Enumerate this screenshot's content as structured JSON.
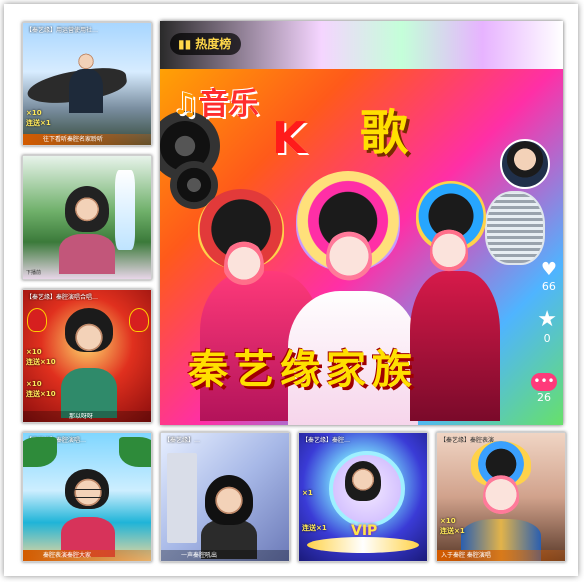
{
  "main": {
    "hot_chip": "热度榜",
    "music": "音乐",
    "k": "K",
    "ge": "歌",
    "family": "秦艺缘家族",
    "likes": "66",
    "comments": "0",
    "shares": "26"
  },
  "tiles": {
    "t1": {
      "top": "【秦艺缘】用运营使用社…",
      "fee1": "×10",
      "fee2": "连送×1",
      "bottom": "往下看听秦腔名家聆听"
    },
    "t2": {
      "top": "",
      "bottom": "下播前"
    },
    "t3": {
      "top": "【秦艺缘】秦腔演唱合唱…",
      "fee1": "×10",
      "fee2": "连送×10",
      "fee3": "×10",
      "fee4": "连送×10",
      "bottom": "那以呀呀"
    },
    "t4": {
      "top": "【秦艺缘】秦腔演唱…",
      "bottom": "秦腔表演秦腔大家"
    },
    "t5": {
      "top": "【秦艺缘】…",
      "bottom": "一声秦腔吼出"
    },
    "t6": {
      "top": "【秦艺缘】秦腔…",
      "fee1": "×1",
      "fee2": "连送×1",
      "vip": "VIP",
      "bottom": ""
    },
    "t7": {
      "top": "【秦艺缘】秦腔表演…",
      "fee1": "×10",
      "fee2": "连送×1",
      "bottom": "入于秦腔 秦腔演唱"
    }
  }
}
